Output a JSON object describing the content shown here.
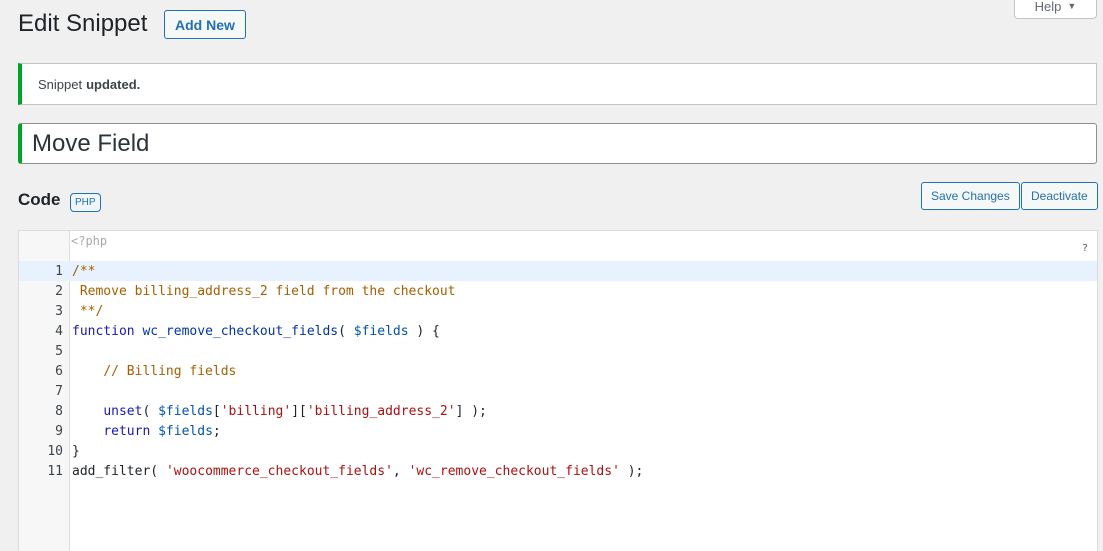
{
  "header": {
    "title": "Edit Snippet",
    "add_new_label": "Add New",
    "help_label": "Help"
  },
  "notice": {
    "prefix": "Snippet",
    "bold": "updated."
  },
  "snippet": {
    "title_value": "Move Field"
  },
  "code_section": {
    "heading": "Code",
    "language_badge": "PHP",
    "save_label": "Save Changes",
    "deactivate_label": "Deactivate"
  },
  "editor": {
    "php_open_tag": "<?php",
    "help_glyph": "?",
    "active_line": 1,
    "lines": [
      {
        "num": "1",
        "text": "/**"
      },
      {
        "num": "2",
        "text": " Remove billing_address_2 field from the checkout"
      },
      {
        "num": "3",
        "text": " **/"
      },
      {
        "num": "4",
        "text": "function wc_remove_checkout_fields( $fields ) {"
      },
      {
        "num": "5",
        "text": ""
      },
      {
        "num": "6",
        "text": "    // Billing fields"
      },
      {
        "num": "7",
        "text": ""
      },
      {
        "num": "8",
        "text": "    unset( $fields['billing']['billing_address_2'] );"
      },
      {
        "num": "9",
        "text": "    return $fields;"
      },
      {
        "num": "10",
        "text": "}"
      },
      {
        "num": "11",
        "text": "add_filter( 'woocommerce_checkout_fields', 'wc_remove_checkout_fields' );"
      }
    ]
  },
  "colors": {
    "accent": "#2271b1",
    "success": "#00a32a",
    "background": "#f0f0f1"
  }
}
